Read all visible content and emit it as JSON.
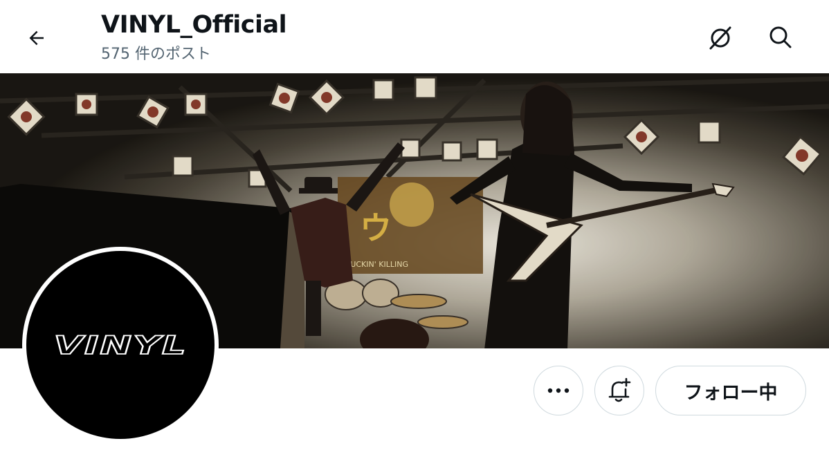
{
  "header": {
    "title": "VINYL_Official",
    "post_count": "575 件のポスト"
  },
  "icons": {
    "back": "arrow-left-icon",
    "grok": "grok-icon",
    "search": "search-icon",
    "more": "more-dots-icon",
    "notify": "bell-plus-icon"
  },
  "avatar": {
    "logo_text": "VINYL"
  },
  "actions": {
    "follow_label": "フォロー中"
  },
  "banner": {
    "backdrop_text_1": "ウ",
    "backdrop_text_2": "FUCKIN' KILLING"
  },
  "colors": {
    "text_primary": "#0f1419",
    "text_secondary": "#536471",
    "border": "#cfd9de"
  }
}
